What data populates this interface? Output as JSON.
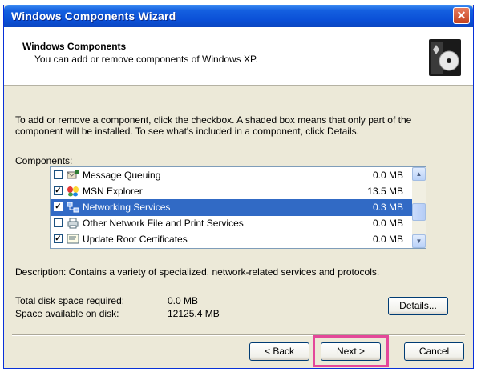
{
  "window": {
    "title": "Windows Components Wizard",
    "close_glyph": "✕"
  },
  "header": {
    "title": "Windows Components",
    "subtitle": "You can add or remove components of Windows XP.",
    "icon": "cd-box-icon"
  },
  "intro": "To add or remove a component, click the checkbox. A shaded box means that only part of the component will be installed. To see what's included in a component, click Details.",
  "components": {
    "label": "Components:",
    "items": [
      {
        "name": "Message Queuing",
        "size": "0.0 MB",
        "checked": false,
        "selected": false,
        "icon": "message-queuing-icon"
      },
      {
        "name": "MSN Explorer",
        "size": "13.5 MB",
        "checked": true,
        "selected": false,
        "icon": "msn-butterfly-icon"
      },
      {
        "name": "Networking Services",
        "size": "0.3 MB",
        "checked": true,
        "selected": true,
        "icon": "networking-icon"
      },
      {
        "name": "Other Network File and Print Services",
        "size": "0.0 MB",
        "checked": false,
        "selected": false,
        "icon": "print-services-icon"
      },
      {
        "name": "Update Root Certificates",
        "size": "0.0 MB",
        "checked": true,
        "selected": false,
        "icon": "certificate-icon"
      }
    ]
  },
  "description": "Description:  Contains a variety of specialized, network-related services and protocols.",
  "disk": {
    "required_label": "Total disk space required:",
    "required_value": "0.0 MB",
    "available_label": "Space available on disk:",
    "available_value": "12125.4 MB"
  },
  "buttons": {
    "details": "Details...",
    "back": "< Back",
    "next": "Next >",
    "cancel": "Cancel"
  },
  "colors": {
    "title_bar": "#0a4fd6",
    "selection": "#316ac5",
    "highlight": "#e4489a"
  }
}
